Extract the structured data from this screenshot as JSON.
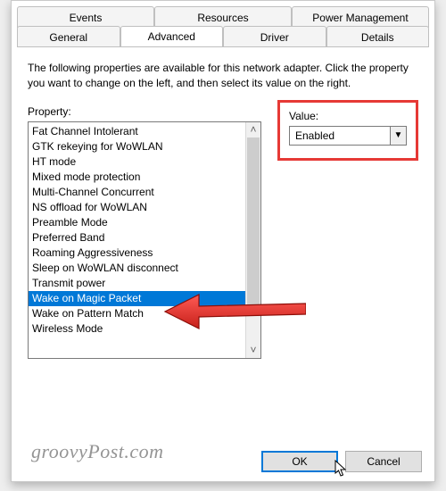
{
  "tabs": {
    "back": [
      "Events",
      "Resources",
      "Power Management"
    ],
    "front": [
      "General",
      "Advanced",
      "Driver",
      "Details"
    ],
    "active": "Advanced"
  },
  "description": "The following properties are available for this network adapter. Click the property you want to change on the left, and then select its value on the right.",
  "property": {
    "label": "Property:",
    "items": [
      "Fat Channel Intolerant",
      "GTK rekeying for WoWLAN",
      "HT mode",
      "Mixed mode protection",
      "Multi-Channel Concurrent",
      "NS offload for WoWLAN",
      "Preamble Mode",
      "Preferred Band",
      "Roaming Aggressiveness",
      "Sleep on WoWLAN disconnect",
      "Transmit power",
      "Wake on Magic Packet",
      "Wake on Pattern Match",
      "Wireless Mode"
    ],
    "selected_index": 11
  },
  "value": {
    "label": "Value:",
    "selected": "Enabled"
  },
  "buttons": {
    "ok": "OK",
    "cancel": "Cancel"
  },
  "watermark": "groovyPost.com",
  "icons": {
    "chevron_up": "▴",
    "chevron_down": "▾",
    "small_up": "˄",
    "small_down": "˅",
    "dropdown_tri": "▼"
  }
}
